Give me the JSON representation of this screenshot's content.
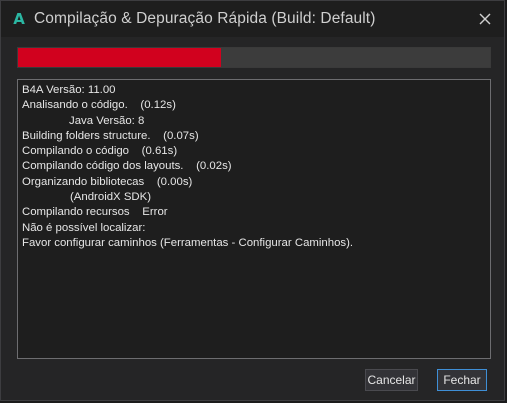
{
  "window": {
    "title": "Compilação & Depuração Rápida (Build: Default)",
    "icon_letter": "A"
  },
  "progress": {
    "fraction": 0.43,
    "color": "#d1011e"
  },
  "log": {
    "lines": [
      {
        "text": "B4A Versão: 11.00",
        "indent": 0
      },
      {
        "text": "Analisando o código.    (0.12s)",
        "indent": 0
      },
      {
        "text": "Java Versão: 8",
        "indent": 1
      },
      {
        "text": "Building folders structure.    (0.07s)",
        "indent": 0
      },
      {
        "text": "Compilando o código    (0.61s)",
        "indent": 0
      },
      {
        "text": "Compilando código dos layouts.    (0.02s)",
        "indent": 0
      },
      {
        "text": "Organizando bibliotecas    (0.00s)",
        "indent": 0
      },
      {
        "text": "(AndroidX SDK)",
        "indent": 2
      },
      {
        "text": "Compilando recursos    Error",
        "indent": 0
      },
      {
        "text": "Não é possível localizar:",
        "indent": 0
      },
      {
        "text": "Favor configurar caminhos (Ferramentas - Configurar Caminhos).",
        "indent": 0
      }
    ]
  },
  "buttons": {
    "cancel_label": "Cancelar",
    "close_label": "Fechar"
  },
  "colors": {
    "accent": "#3f8fd6",
    "app_icon": "#2bb7a3"
  }
}
